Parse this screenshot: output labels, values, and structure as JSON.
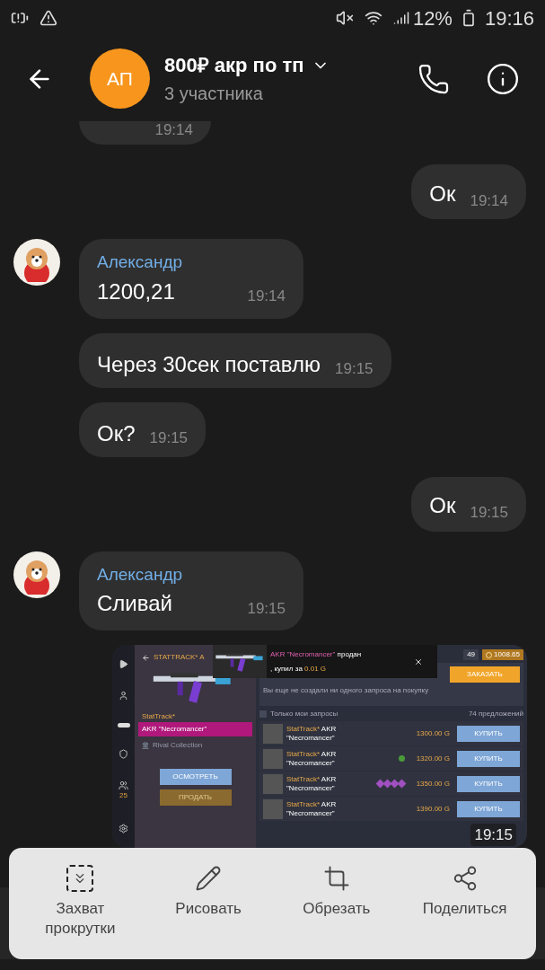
{
  "status_bar": {
    "battery_percent": "12%",
    "time": "19:16"
  },
  "header": {
    "avatar_initials": "АП",
    "title": "800₽ акр по тп",
    "subtitle": "3 участника"
  },
  "messages": [
    {
      "kind": "partial_in",
      "time": "19:14"
    },
    {
      "kind": "out",
      "text": "Ок",
      "time": "19:14"
    },
    {
      "kind": "in",
      "sender": "Александр",
      "text": "1200,21",
      "time": "19:14",
      "avatar": true
    },
    {
      "kind": "in",
      "text": "Через 30сек поставлю",
      "time": "19:15",
      "avatar": false
    },
    {
      "kind": "in",
      "text": "Ок?",
      "time": "19:15",
      "avatar": false
    },
    {
      "kind": "out",
      "text": "Ок",
      "time": "19:15"
    },
    {
      "kind": "in",
      "sender": "Александр",
      "text": "Сливай",
      "time": "19:15",
      "avatar": true
    },
    {
      "kind": "image",
      "time": "19:15"
    }
  ],
  "shared_image": {
    "title": "STATTRACK* A",
    "badge_count": "25",
    "stattrack": "StatTrack*",
    "item_name": "AKR \"Necromancer\"",
    "collection": "Rival Collection",
    "inspect_button": "ОСМОТРЕТЬ",
    "sell_button": "ПРОДАТЬ",
    "toast": {
      "item": "AKR \"Necromancer\"",
      "status": "продан",
      "detail": ", купил за",
      "amount": "0.01 G"
    },
    "currency_1": "49",
    "currency_2": "1008.65",
    "order_button": "ЗАКАЗАТЬ",
    "empty_note": "Вы еще не создали ни одного запроса на покупку",
    "filter_checked": false,
    "filter_label": "Только мои запросы",
    "offers_count": "74 предложений",
    "listings": [
      {
        "prefix": "StatTrack*",
        "name": "AKR",
        "name2": "\"Necromancer\"",
        "price": "1300.00 G",
        "buy": "КУПИТЬ"
      },
      {
        "prefix": "StatTrack*",
        "name": "AKR",
        "name2": "\"Necromancer\"",
        "price": "1320.00 G",
        "buy": "КУПИТЬ",
        "stickers": [
          {
            "kind": "frog"
          }
        ]
      },
      {
        "prefix": "StatTrack*",
        "name": "AKR",
        "name2": "\"Necromancer\"",
        "price": "1350.00 G",
        "buy": "КУПИТЬ",
        "stickers": [
          {
            "kind": "gem"
          },
          {
            "kind": "gem"
          },
          {
            "kind": "gem"
          },
          {
            "kind": "gem"
          }
        ]
      },
      {
        "prefix": "StatTrack*",
        "name": "AKR",
        "name2": "\"Necromancer\"",
        "price": "1390.00 G",
        "buy": "КУПИТЬ"
      }
    ]
  },
  "screenshot_toolbar": [
    {
      "kind": "scroll",
      "label": "Захват прокрутки"
    },
    {
      "kind": "draw",
      "label": "Рисовать"
    },
    {
      "kind": "crop",
      "label": "Обрезать"
    },
    {
      "kind": "share",
      "label": "Поделиться"
    }
  ]
}
